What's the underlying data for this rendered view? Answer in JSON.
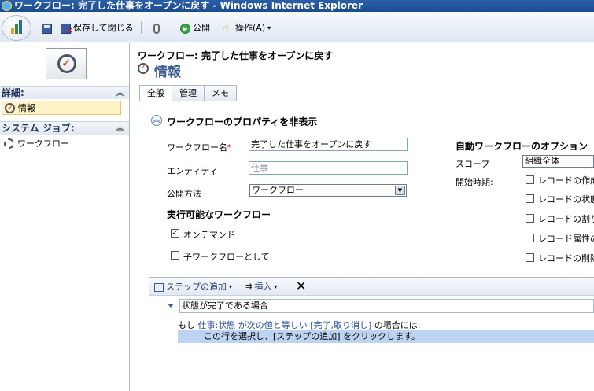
{
  "window": {
    "title": "ワークフロー: 完了した仕事をオープンに戻す - Windows Internet Explorer"
  },
  "toolbar": {
    "save_close_label": "保存して閉じる",
    "publish_label": "公開",
    "actions_label": "操作(A)"
  },
  "nav": {
    "details_header": "詳細:",
    "info_item": "情報",
    "system_jobs_header": "システム ジョブ:",
    "workflow_item": "ワークフロー"
  },
  "header": {
    "breadcrumb": "ワークフロー: 完了した仕事をオープンに戻す",
    "title": "情報"
  },
  "tabs": [
    "全般",
    "管理",
    "メモ"
  ],
  "section": {
    "toggle_label": "ワークフローのプロパティを非表示"
  },
  "form": {
    "name_label": "ワークフロー名",
    "name_value": "完了した仕事をオープンに戻す",
    "entity_label": "エンティティ",
    "entity_value": "仕事",
    "publish_method_label": "公開方法",
    "publish_method_value": "ワークフロー",
    "available_header": "実行可能なワークフロー",
    "on_demand_label": "オンデマンド",
    "on_demand_checked": true,
    "child_label": "子ワークフローとして",
    "child_checked": false
  },
  "auto_options": {
    "header": "自動ワークフローのオプション",
    "scope_label": "スコープ",
    "scope_value": "組織全体",
    "start_label": "開始時期:",
    "triggers": [
      "レコードの作成",
      "レコードの状態",
      "レコードの割り当",
      "レコード属性の",
      "レコードの削除"
    ]
  },
  "steps": {
    "add_step_label": "ステップの追加",
    "insert_label": "挿入",
    "step_title": "状態が完了である場合",
    "cond_prefix": "もし",
    "cond_field": "仕事:状態",
    "cond_op": "が次の値と等しい",
    "cond_values": "[完了,取り消し]",
    "cond_suffix": "の場合には:",
    "hint": "この行を選択し、[ステップの追加] をクリックします。"
  }
}
